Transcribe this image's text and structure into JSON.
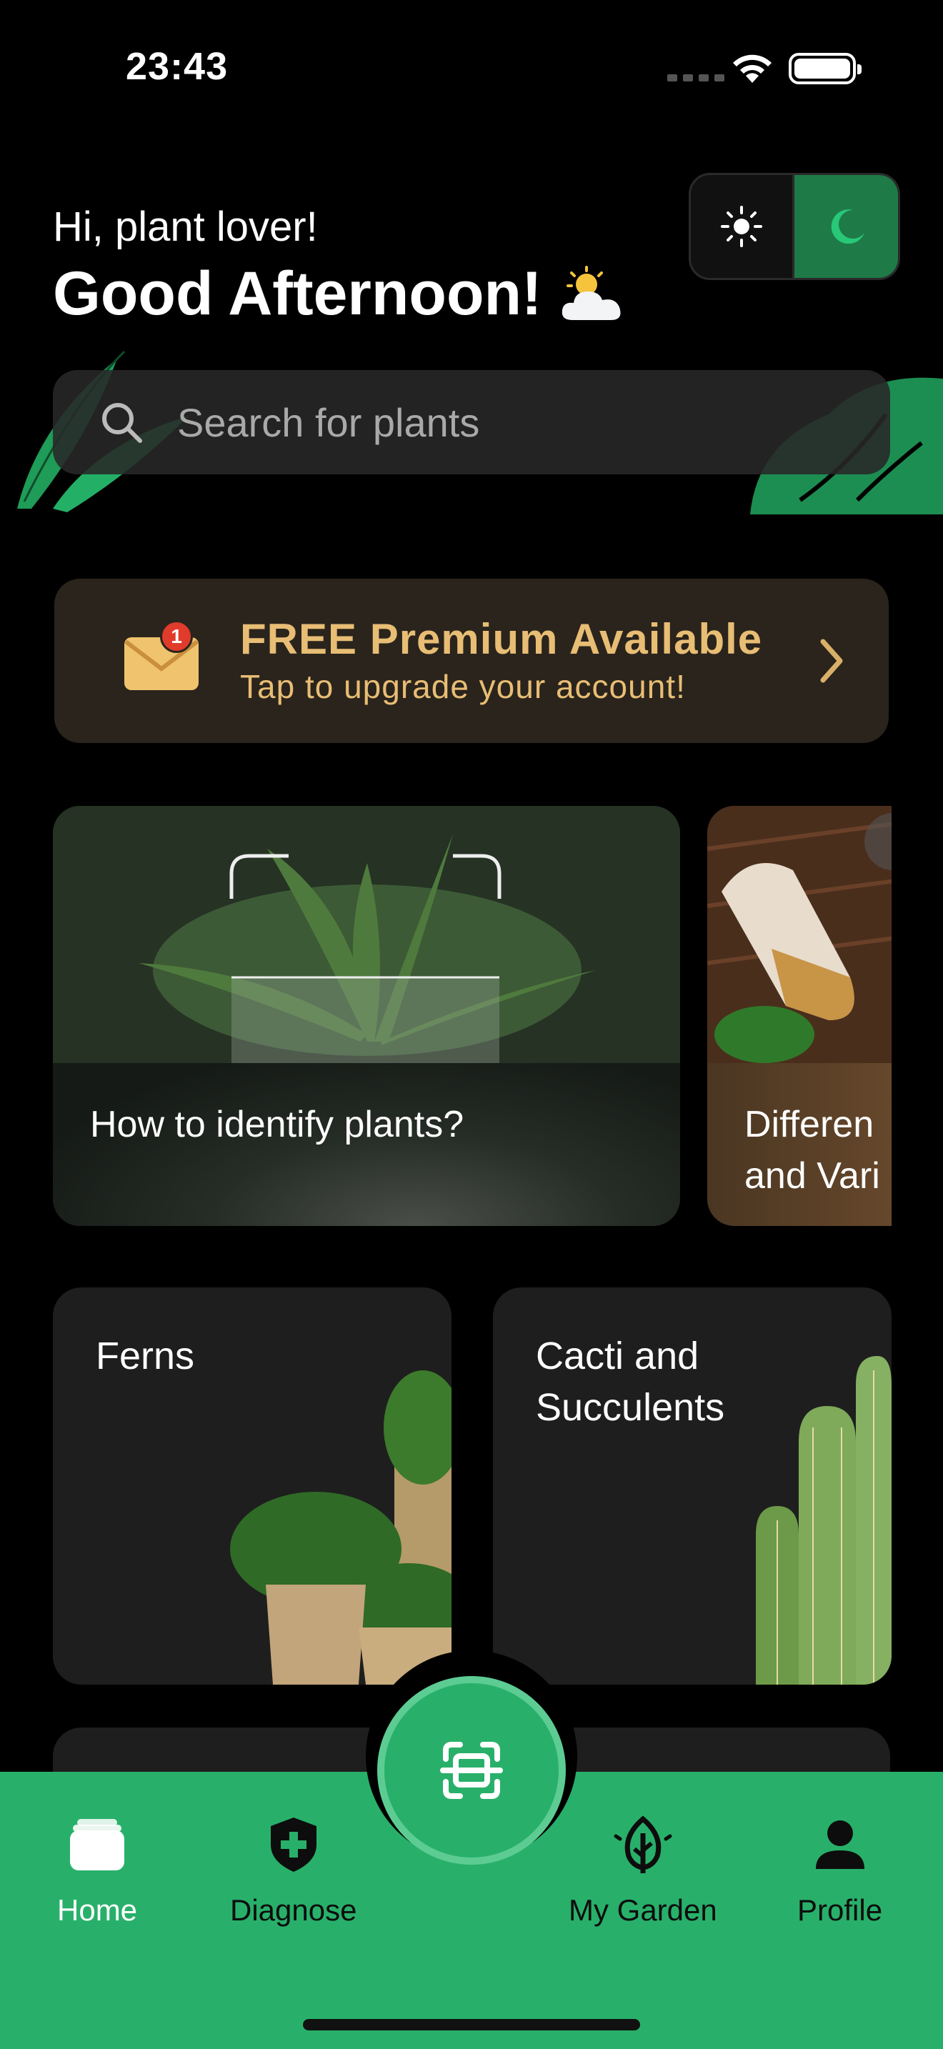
{
  "status_bar": {
    "time": "23:43"
  },
  "header": {
    "greeting": "Hi, plant lover!",
    "headline": "Good Afternoon!",
    "weather_icon": "cloud-sun-icon"
  },
  "theme_toggle": {
    "options": [
      "light",
      "dark"
    ],
    "selected": "dark"
  },
  "search": {
    "placeholder": "Search for plants"
  },
  "premium": {
    "title": "FREE Premium Available",
    "subtitle": "Tap to upgrade your account!",
    "badge_count": "1"
  },
  "articles": [
    {
      "title": "How to identify plants?"
    },
    {
      "title": "Differen\nand Vari"
    }
  ],
  "categories": [
    {
      "title": "Ferns"
    },
    {
      "title": "Cacti and\nSucculents"
    }
  ],
  "nav": {
    "items": [
      {
        "label": "Home",
        "active": true
      },
      {
        "label": "Diagnose",
        "active": false
      },
      {
        "label": "My Garden",
        "active": false
      },
      {
        "label": "Profile",
        "active": false
      }
    ],
    "scan_icon": "scan-icon"
  },
  "colors": {
    "accent": "#28b06a",
    "premium_text": "#e8bd74",
    "card_bg": "#1e1e1e"
  }
}
